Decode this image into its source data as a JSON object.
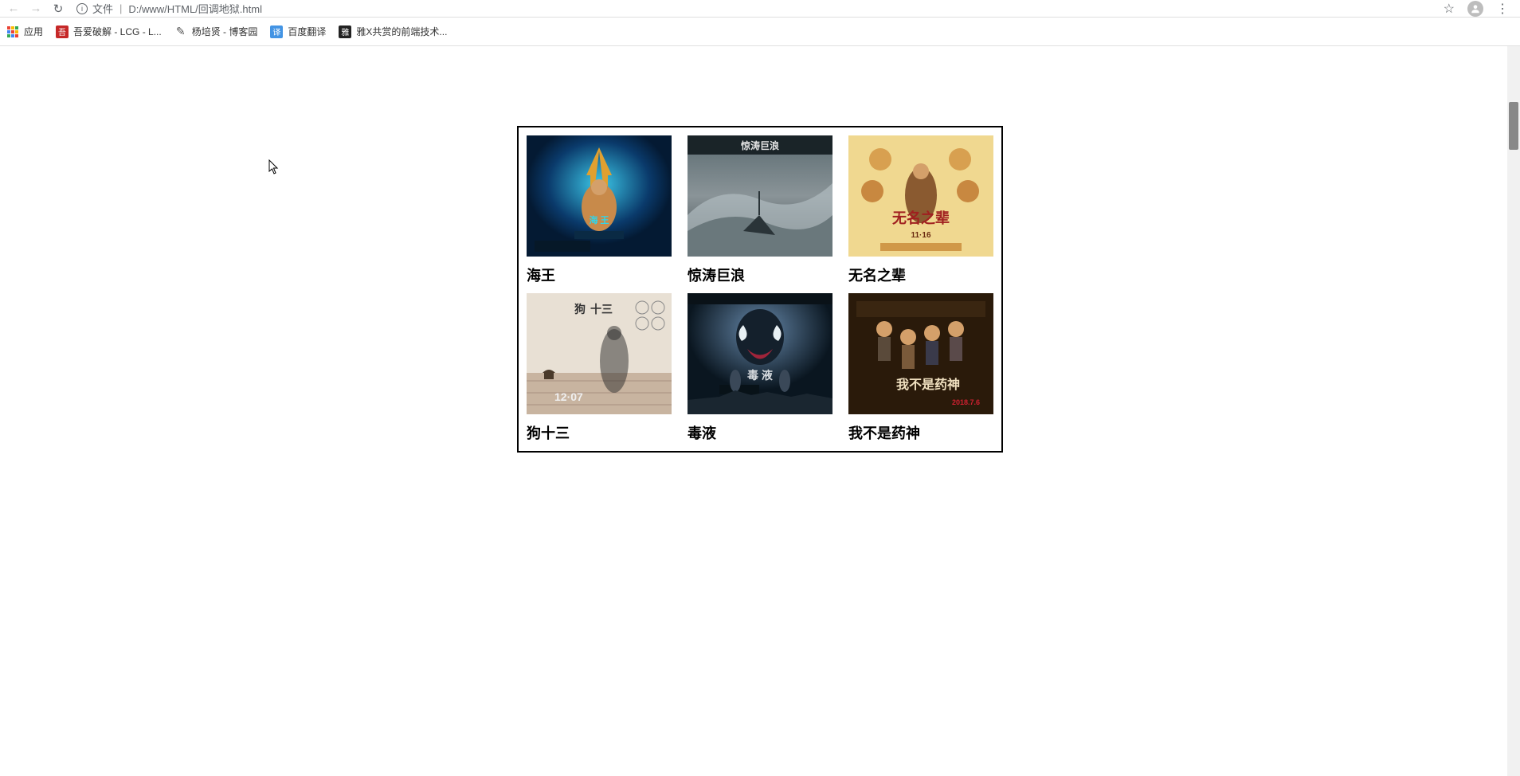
{
  "browser": {
    "url_prefix": "文件",
    "url": "D:/www/HTML/回调地狱.html"
  },
  "bookmarks": {
    "apps": "应用",
    "items": [
      {
        "label": "吾爱破解 - LCG - L..."
      },
      {
        "label": "杨培贤 - 博客园"
      },
      {
        "label": "百度翻译"
      },
      {
        "label": "雅X共赏的前端技术..."
      }
    ]
  },
  "movies": [
    {
      "title": "海王"
    },
    {
      "title": "惊涛巨浪"
    },
    {
      "title": "无名之辈"
    },
    {
      "title": "狗十三"
    },
    {
      "title": "毒液"
    },
    {
      "title": "我不是药神"
    }
  ]
}
